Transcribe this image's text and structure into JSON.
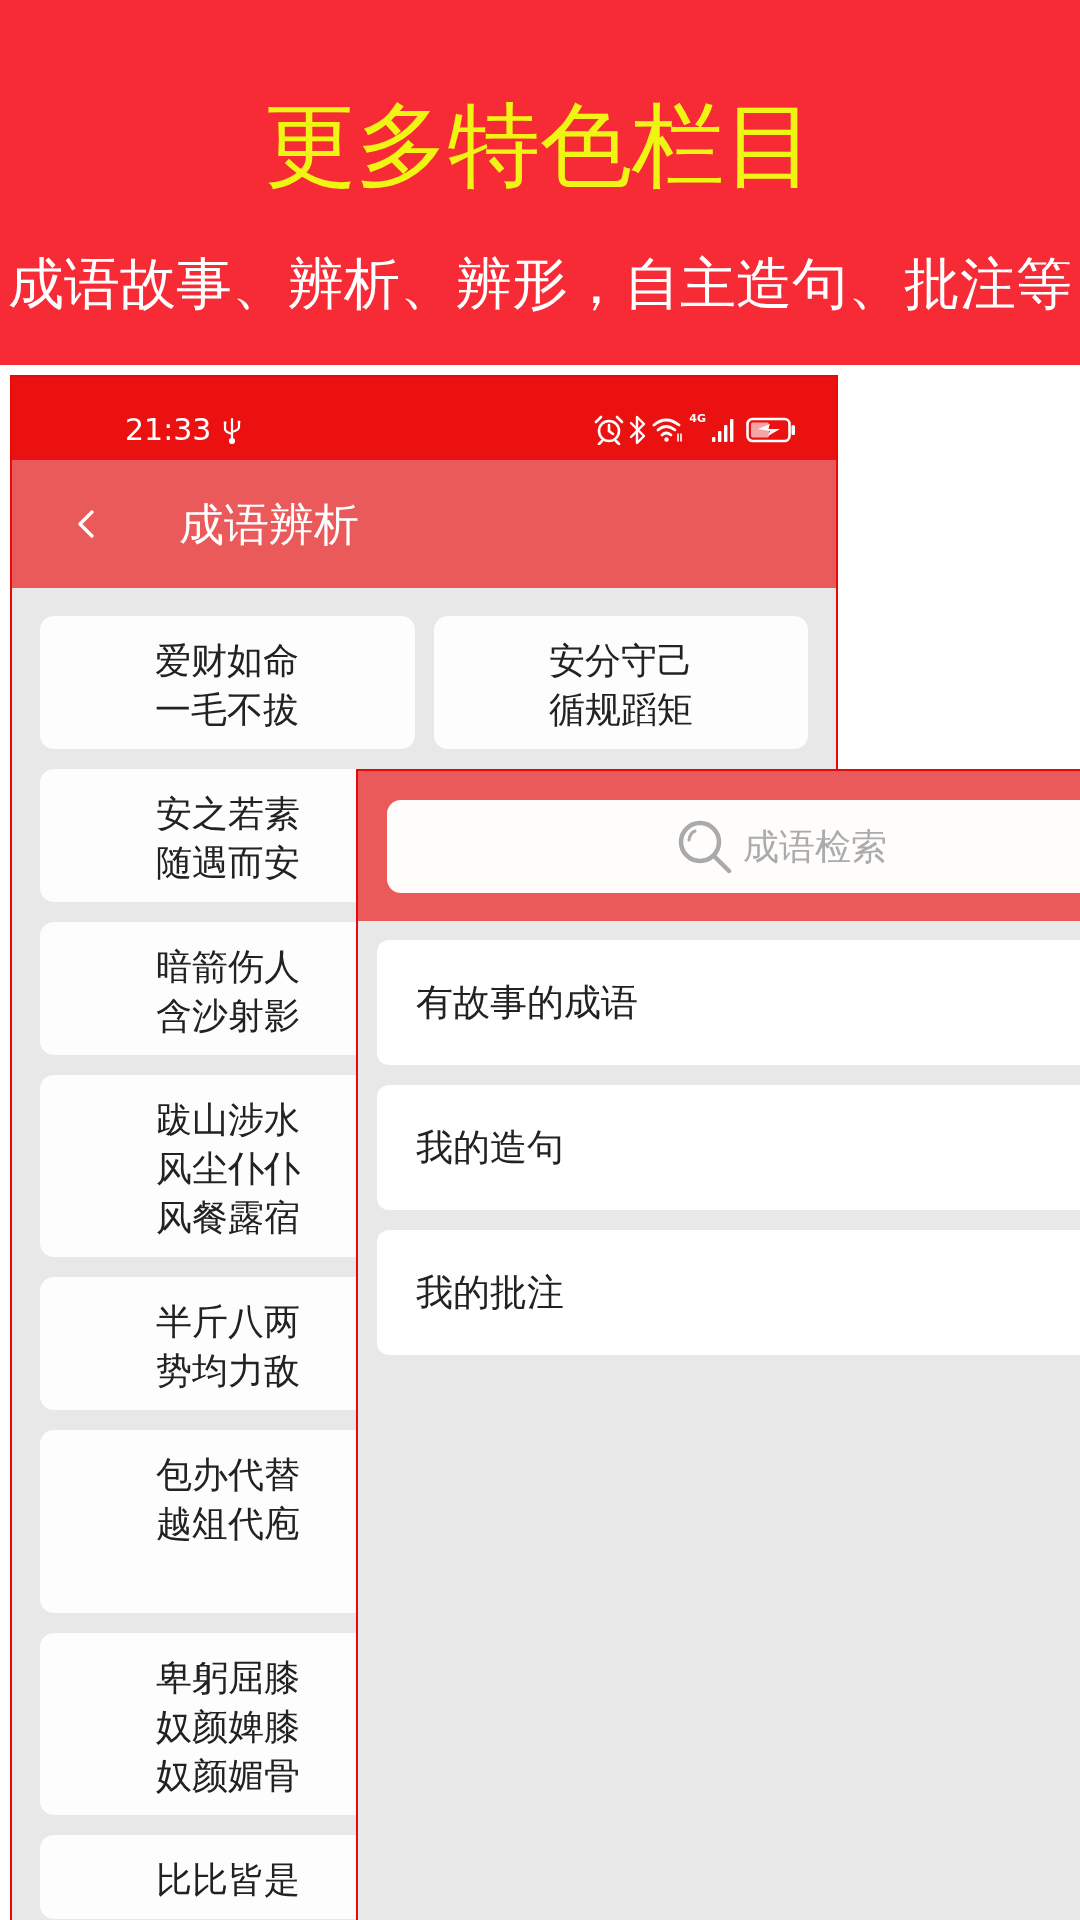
{
  "banner": {
    "title": "更多特色栏目",
    "subtitle": "成语故事、辨析、辨形，自主造句、批注等"
  },
  "analysis_screen": {
    "status_bar": {
      "time": "21:33",
      "network_type": "4G"
    },
    "app_bar": {
      "title": "成语辨析"
    },
    "card_rows": [
      [
        {
          "lines": [
            "爱财如命",
            "一毛不拔"
          ]
        },
        {
          "lines": [
            "安分守己",
            "循规蹈矩"
          ]
        }
      ],
      [
        {
          "lines": [
            "安之若素",
            "随遇而安"
          ]
        }
      ],
      [
        {
          "lines": [
            "暗箭伤人",
            "含沙射影"
          ]
        }
      ],
      [
        {
          "lines": [
            "跋山涉水",
            "风尘仆仆",
            "风餐露宿"
          ]
        }
      ],
      [
        {
          "lines": [
            "半斤八两",
            "势均力敌"
          ]
        }
      ],
      [
        {
          "lines": [
            "包办代替",
            "越俎代庖"
          ]
        }
      ],
      [
        {
          "lines": [
            "卑躬屈膝",
            "奴颜婢膝",
            "奴颜媚骨"
          ]
        }
      ],
      [
        {
          "lines": [
            "比比皆是"
          ]
        }
      ]
    ]
  },
  "search_screen": {
    "search": {
      "placeholder": "成语检索"
    },
    "menu_items": [
      {
        "label": "有故事的成语"
      },
      {
        "label": "我的造句"
      },
      {
        "label": "我的批注"
      }
    ]
  }
}
